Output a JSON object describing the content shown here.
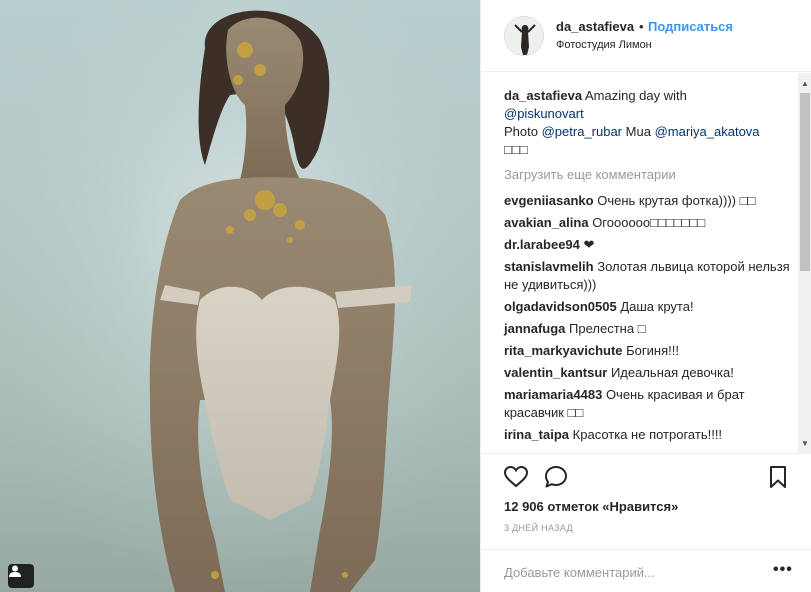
{
  "header": {
    "username": "da_astafieva",
    "dot": "•",
    "follow_label": "Подписаться",
    "location": "Фотостудия Лимон"
  },
  "caption": {
    "username": "da_astafieva",
    "text1": "Amazing day with",
    "mention1": "@piskunovart",
    "photo_label": "Photo",
    "mention2": "@petra_rubar",
    "mua_label": "Mua",
    "mention3": "@mariya_akatova",
    "emojis": "□□□"
  },
  "load_more": "Загрузить еще комментарии",
  "comments": [
    {
      "user": "evgeniiasanko",
      "text": "Очень крутая фотка)))) □□"
    },
    {
      "user": "avakian_alina",
      "text": "Огоооооо□□□□□□□"
    },
    {
      "user": "dr.larabee94",
      "text": "❤"
    },
    {
      "user": "stanislavmelih",
      "text": "Золотая львица которой нельзя не удивиться)))"
    },
    {
      "user": "olgadavidson0505",
      "text": "Даша крута!"
    },
    {
      "user": "jannafuga",
      "text": "Прелестна □"
    },
    {
      "user": "rita_markyavichute",
      "text": "Богиня!!!"
    },
    {
      "user": "valentin_kantsur",
      "text": "Идеальная девочка!"
    },
    {
      "user": "mariamaria4483",
      "text": "Очень красивая и брат красавчик □□"
    },
    {
      "user": "irina_taipa",
      "text": "Красотка не потрогать!!!!"
    }
  ],
  "likes": "12 906 отметок «Нравится»",
  "timestamp": "3 ДНЕЙ НАЗАД",
  "comment_input": {
    "placeholder": "Добавьте комментарий...",
    "value": ""
  },
  "more_options": "•••",
  "icons": {
    "like": "heart-icon",
    "comment": "comment-bubble-icon",
    "save": "bookmark-icon",
    "tag": "user-tag-icon"
  },
  "colors": {
    "accent": "#3897f0",
    "link": "#003569",
    "muted": "#999999",
    "text": "#262626"
  }
}
